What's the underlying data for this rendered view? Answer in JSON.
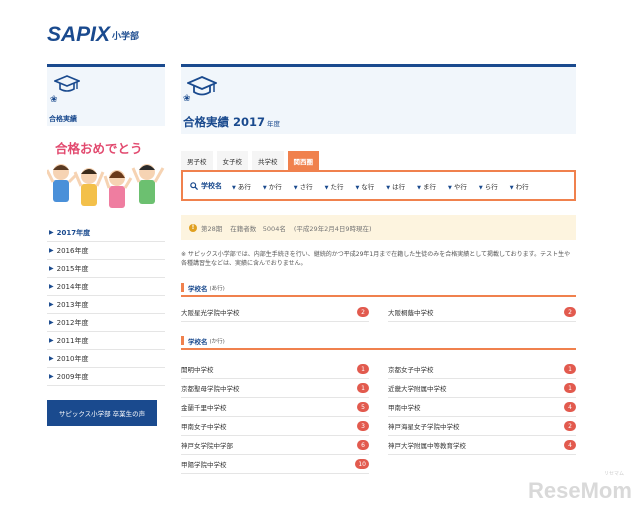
{
  "brand": {
    "logo": "SAPIX",
    "sub": "小学部"
  },
  "sidebar": {
    "title": "合格実績",
    "banner_text": "合格おめでとう",
    "years": [
      "2017年度",
      "2016年度",
      "2015年度",
      "2014年度",
      "2013年度",
      "2012年度",
      "2011年度",
      "2010年度",
      "2009年度"
    ],
    "active_year": "2017年度",
    "alumni_button": "サピックス小学部 卒業生の声"
  },
  "main": {
    "title": "合格実績 2017",
    "title_suffix": "年度",
    "tabs": [
      "男子校",
      "女子校",
      "共学校",
      "関西圏"
    ],
    "active_tab": "関西圏",
    "search_label": "学校名",
    "kana": [
      "あ行",
      "か行",
      "さ行",
      "た行",
      "な行",
      "は行",
      "ま行",
      "や行",
      "ら行",
      "わ行"
    ],
    "info": {
      "period": "第28期",
      "enrolled": "在籍者数　5004名",
      "date": "(平成29年2月4日9時現在)"
    },
    "note": "※ サピックス小学部では、内部生手続きを行い、継続的かつ平成29年1月まで在籍した生徒のみを合格実績として掲載しております。テスト生や各種講習生などは、実績に含んでおりません。",
    "sections": [
      {
        "label": "学校名",
        "sub": "(あ行)",
        "left": [
          {
            "name": "大阪星光学院中学校",
            "count": "2"
          }
        ],
        "right": [
          {
            "name": "大阪桐蔭中学校",
            "count": "2"
          }
        ]
      },
      {
        "label": "学校名",
        "sub": "(か行)",
        "left": [
          {
            "name": "開明中学校",
            "count": "1"
          },
          {
            "name": "京都聖母学院中学校",
            "count": "1"
          },
          {
            "name": "金蘭千里中学校",
            "count": "5"
          },
          {
            "name": "甲南女子中学校",
            "count": "3"
          },
          {
            "name": "神戸女学院中学部",
            "count": "6"
          },
          {
            "name": "甲陽学院中学校",
            "count": "10"
          }
        ],
        "right": [
          {
            "name": "京都女子中学校",
            "count": "1"
          },
          {
            "name": "近畿大学附属中学校",
            "count": "1"
          },
          {
            "name": "甲南中学校",
            "count": "4"
          },
          {
            "name": "神戸海星女子学院中学校",
            "count": "2"
          },
          {
            "name": "神戸大学附属中等教育学校",
            "count": "4"
          }
        ]
      }
    ]
  },
  "watermark": "ReseMom",
  "watermark_small": "リセマム"
}
